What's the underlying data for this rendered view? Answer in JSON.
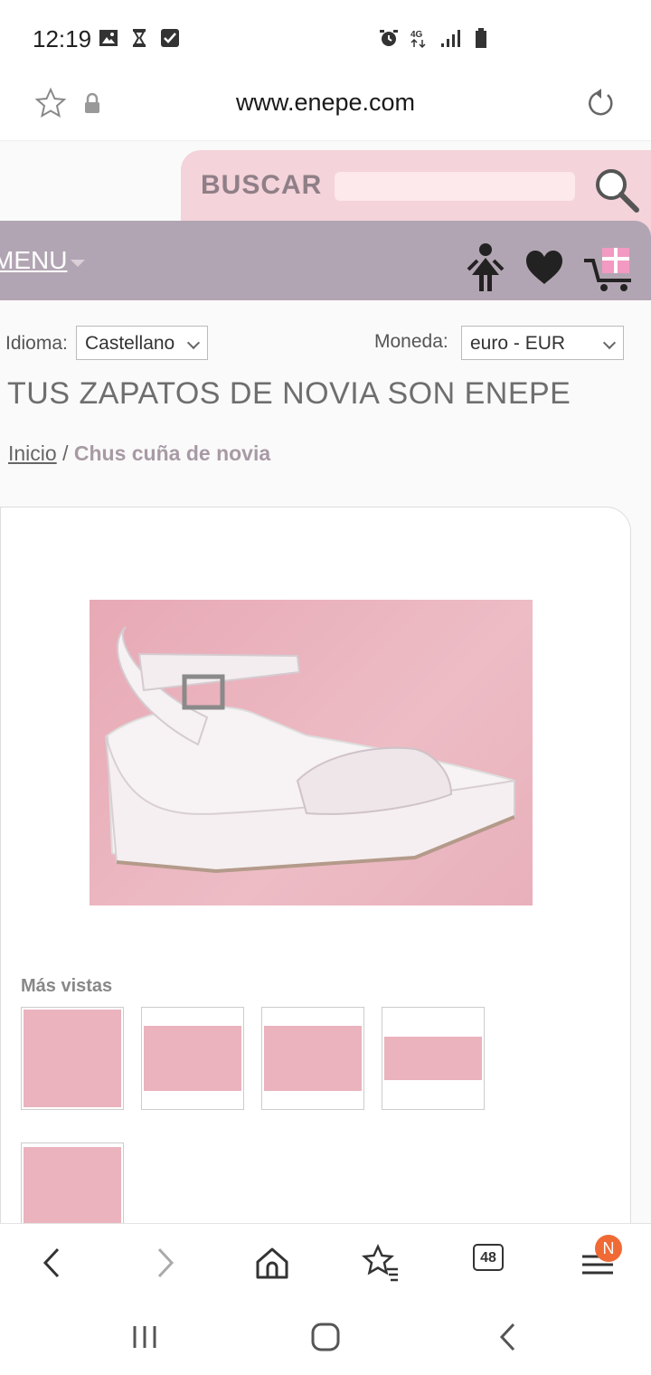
{
  "status_bar": {
    "time": "12:19",
    "network": "4G",
    "left_icons": [
      "gallery-icon",
      "hourglass-icon",
      "checkbox-icon"
    ],
    "right_icons": [
      "alarm-icon",
      "network-4g-icon",
      "signal-icon",
      "battery-icon"
    ]
  },
  "browser": {
    "url": "www.enepe.com",
    "tab_count": "48",
    "menu_badge": "N"
  },
  "header": {
    "search_label": "BUSCAR",
    "search_placeholder": "",
    "menu_label": "MENU"
  },
  "settings": {
    "language_label": "Idioma:",
    "language_value": "Castellano",
    "currency_label": "Moneda:",
    "currency_value": "euro - EUR"
  },
  "page": {
    "headline": "TUS ZAPATOS DE NOVIA SON ENEPE"
  },
  "breadcrumb": {
    "home": "Inicio",
    "separator": " / ",
    "current": "Chus cuña de novia"
  },
  "product": {
    "more_views_label": "Más vistas",
    "thumbnail_count": 5
  },
  "colors": {
    "search_bg": "#f4d3da",
    "menu_bg": "#b2a5b3",
    "photo_bg": "#e7a9b5",
    "badge": "#f06a35"
  }
}
